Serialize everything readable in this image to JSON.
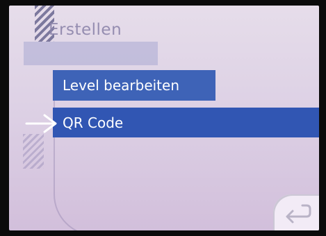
{
  "menu": {
    "title": "Erstellen",
    "items": [
      {
        "label": "Level bearbeiten",
        "selected": false
      },
      {
        "label": "QR Code",
        "selected": true
      }
    ]
  },
  "icons": {
    "selection": "arrow-right-icon",
    "back": "return-arrow-icon",
    "decoration": "striped-pattern"
  },
  "colors": {
    "item_background": "#3e63b7",
    "selected_item_background": "#3156b3",
    "screen_background": "#e6ddea",
    "item_text": "#ffffff"
  }
}
